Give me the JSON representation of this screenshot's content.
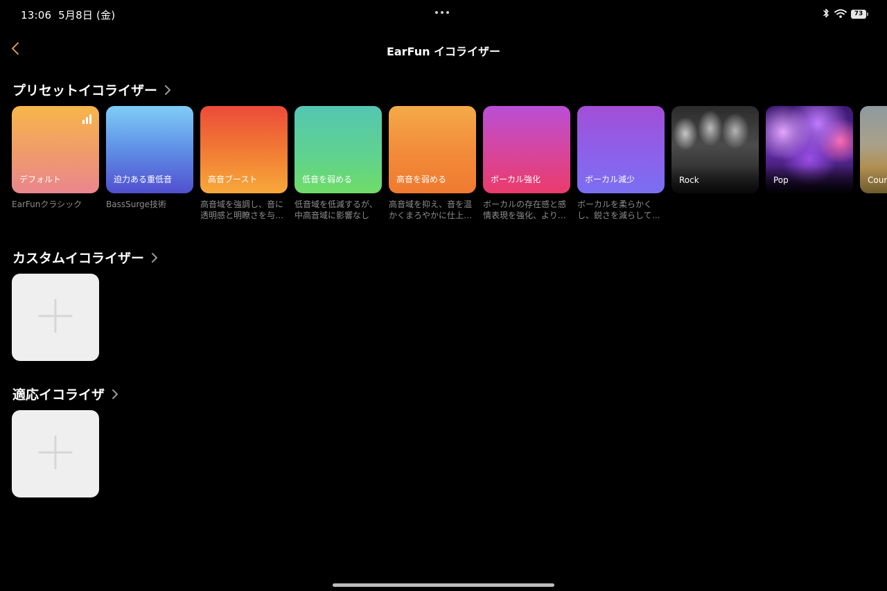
{
  "status_bar": {
    "time": "13:06",
    "date": "5月8日 (金)",
    "battery": "73"
  },
  "header": {
    "title": "EarFun イコライザー"
  },
  "presets_section": {
    "title": "プリセットイコライザー",
    "items": [
      {
        "label": "デフォルト",
        "desc": "EarFunクラシック",
        "active": true,
        "gradient_key": "default"
      },
      {
        "label": "迫力ある重低音",
        "desc": "BassSurge技術",
        "gradient_key": "bass"
      },
      {
        "label": "高音ブースト",
        "desc": "高音域を強調し、音に透明感と明瞭さを与…",
        "gradient_key": "treble"
      },
      {
        "label": "低音を弱める",
        "desc": "低音域を低減するが、中高音域に影響なし",
        "gradient_key": "lowbass"
      },
      {
        "label": "高音を弱める",
        "desc": "高音域を抑え、音を温かくまろやかに仕上…",
        "gradient_key": "lowtreb"
      },
      {
        "label": "ボーカル強化",
        "desc": "ボーカルの存在感と感情表現を強化、より…",
        "gradient_key": "vocal"
      },
      {
        "label": "ボーカル減少",
        "desc": "ボーカルを柔らかくし、鋭さを減らして…",
        "gradient_key": "vocaldn"
      },
      {
        "label": "Rock",
        "desc": "",
        "gradient_key": "rock"
      },
      {
        "label": "Pop",
        "desc": "",
        "gradient_key": "pop"
      },
      {
        "label": "Coun",
        "desc": "",
        "gradient_key": "country"
      }
    ]
  },
  "custom_section": {
    "title": "カスタムイコライザー"
  },
  "adaptive_section": {
    "title": "適応イコライザ"
  },
  "icons": {
    "back": "chevron-left-icon",
    "section_more": "chevron-right-icon",
    "add": "plus-icon",
    "active_preset": "equalizer-bars-icon",
    "bluetooth": "bluetooth-icon",
    "wifi": "wifi-icon"
  },
  "colors": {
    "background": "#000000",
    "accent_back": "#f0a84a",
    "muted_text": "#8d8d8d",
    "add_tile": "#efefef"
  }
}
